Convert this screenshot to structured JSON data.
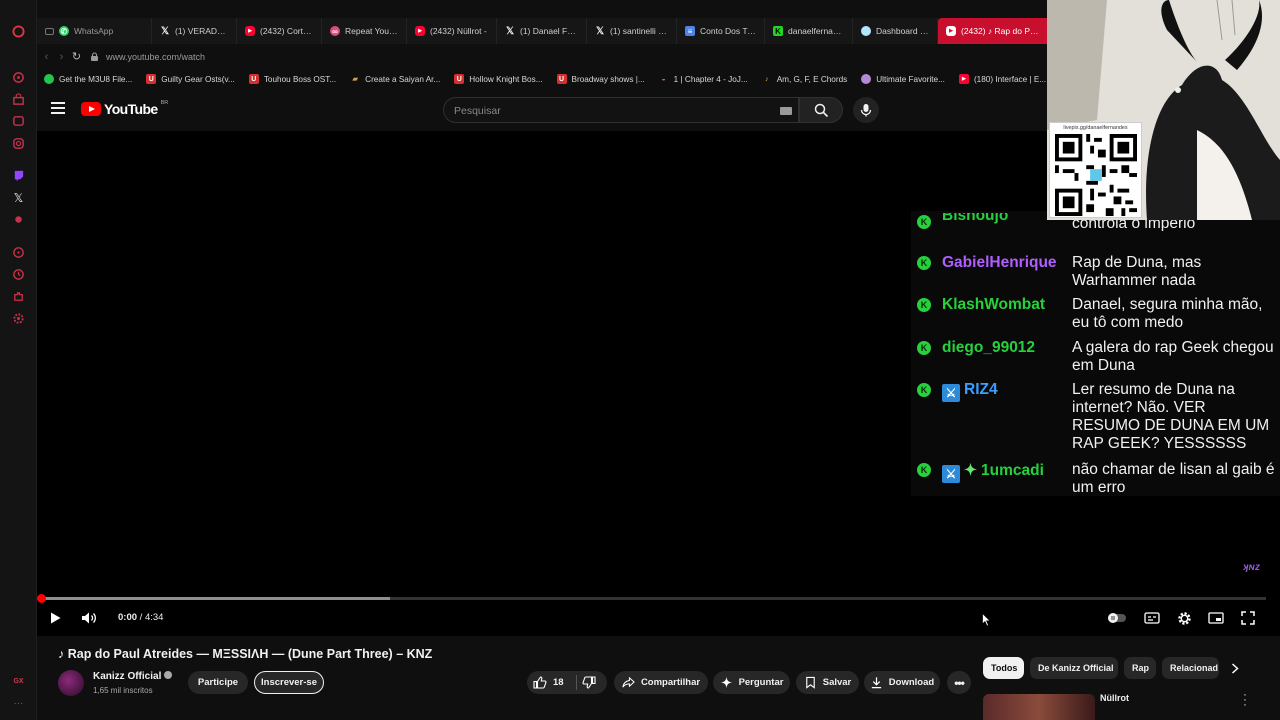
{
  "browser": {
    "tabs": [
      {
        "label": "WhatsApp",
        "icon": "whatsapp-icon",
        "kind": "wa"
      },
      {
        "label": "(1) VERADE NEV",
        "icon": "x-icon",
        "kind": "x"
      },
      {
        "label": "(2432) Cortes d",
        "icon": "youtube-icon",
        "kind": "yt"
      },
      {
        "label": "Repeat YouTube",
        "icon": "repeat-icon",
        "kind": "rp"
      },
      {
        "label": "(2432) Nüllrot -",
        "icon": "youtube-icon",
        "kind": "yt"
      },
      {
        "label": "(1) Danael Ferna",
        "icon": "x-icon",
        "kind": "x"
      },
      {
        "label": "(1) santinelli – B",
        "icon": "x-icon",
        "kind": "x"
      },
      {
        "label": "Conto Dos Tres",
        "icon": "docs-icon",
        "kind": "doc"
      },
      {
        "label": "danaelfernande",
        "icon": "kick-icon",
        "kind": "kick"
      },
      {
        "label": "Dashboard - Liv",
        "icon": "dashboard-icon",
        "kind": "dash"
      },
      {
        "label": "(2432) ♪ Rap do Paul",
        "icon": "youtube-icon",
        "kind": "yt",
        "active": true
      }
    ],
    "url": "www.youtube.com/watch",
    "bookmarks": [
      {
        "label": "Get the M3U8 File...",
        "icon": "green-circle-icon",
        "color": "#25c44a"
      },
      {
        "label": "Guilty Gear Osts(v...",
        "icon": "udemy-u-icon",
        "color": "#d5302e"
      },
      {
        "label": "Touhou Boss OST...",
        "icon": "udemy-u-icon",
        "color": "#d5302e"
      },
      {
        "label": "Create a Saiyan Ar...",
        "icon": "folder-icon",
        "color": "#c8a24a"
      },
      {
        "label": "Hollow Knight Bos...",
        "icon": "udemy-u-icon",
        "color": "#d5302e"
      },
      {
        "label": "Broadway shows |...",
        "icon": "udemy-u-icon",
        "color": "#d5302e"
      },
      {
        "label": "1 | Chapter 4 - JoJ...",
        "icon": "cake-icon",
        "color": "#e05a5a"
      },
      {
        "label": "Am, G, F, E Chords",
        "icon": "guitar-icon",
        "color": "#e3b23a"
      },
      {
        "label": "Ultimate Favorite...",
        "icon": "ball-icon",
        "color": "#b48ad8"
      },
      {
        "label": "(180) Interface | E...",
        "icon": "youtube-icon",
        "color": "#ff0033"
      }
    ]
  },
  "youtube": {
    "logo_text": "YouTube",
    "country_code": "BR",
    "search_placeholder": "Pesquisar"
  },
  "video": {
    "time_current": "0:00",
    "time_total": "4:34",
    "buffered_fraction": 0.285,
    "chat": [
      {
        "user": "Bishoujo",
        "color": "#26d13b",
        "message": "quem controla melanina controla o imperio",
        "badges": []
      },
      {
        "user": "GabielHenrique",
        "color": "#b15dff",
        "message": "Rap de Duna, mas Warhammer nada",
        "badges": []
      },
      {
        "user": "KlashWombat",
        "color": "#26d13b",
        "message": "Danael, segura minha mão, eu tô com medo",
        "badges": []
      },
      {
        "user": "diego_99012",
        "color": "#26d13b",
        "message": "A galera do rap Geek chegou em Duna",
        "badges": []
      },
      {
        "user": "RIZ4",
        "color": "#39a0ff",
        "message": "Ler resumo de Duna na internet? Não. VER RESUMO DE DUNA EM UM RAP GEEK? YESSSSSS",
        "badges": [
          "mod"
        ]
      },
      {
        "user": "1umcadi",
        "color": "#26d13b",
        "message": "não chamar de lisan al gaib é um erro",
        "badges": [
          "mod",
          "spark"
        ]
      }
    ],
    "qr_url": "livepix.gg/danaelfernandes"
  },
  "watch": {
    "title": "♪ Rap do Paul Atreides — MΞSSIΛH — (Dune Part Three) – KNZ",
    "channel_name": "Kanizz Official",
    "channel_subs": "1,65 mil inscritos",
    "join_label": "Participe",
    "subscribe_label": "Inscrever-se",
    "like_count": "18",
    "share_label": "Compartilhar",
    "ask_label": "Perguntar",
    "save_label": "Salvar",
    "download_label": "Download",
    "chips": [
      "Todos",
      "De Kanizz Official",
      "Rap",
      "Relacionad"
    ],
    "rec_title": "Nüllrot"
  },
  "colors": {
    "accent_red": "#ff0000",
    "active_tab": "#c8102e"
  }
}
